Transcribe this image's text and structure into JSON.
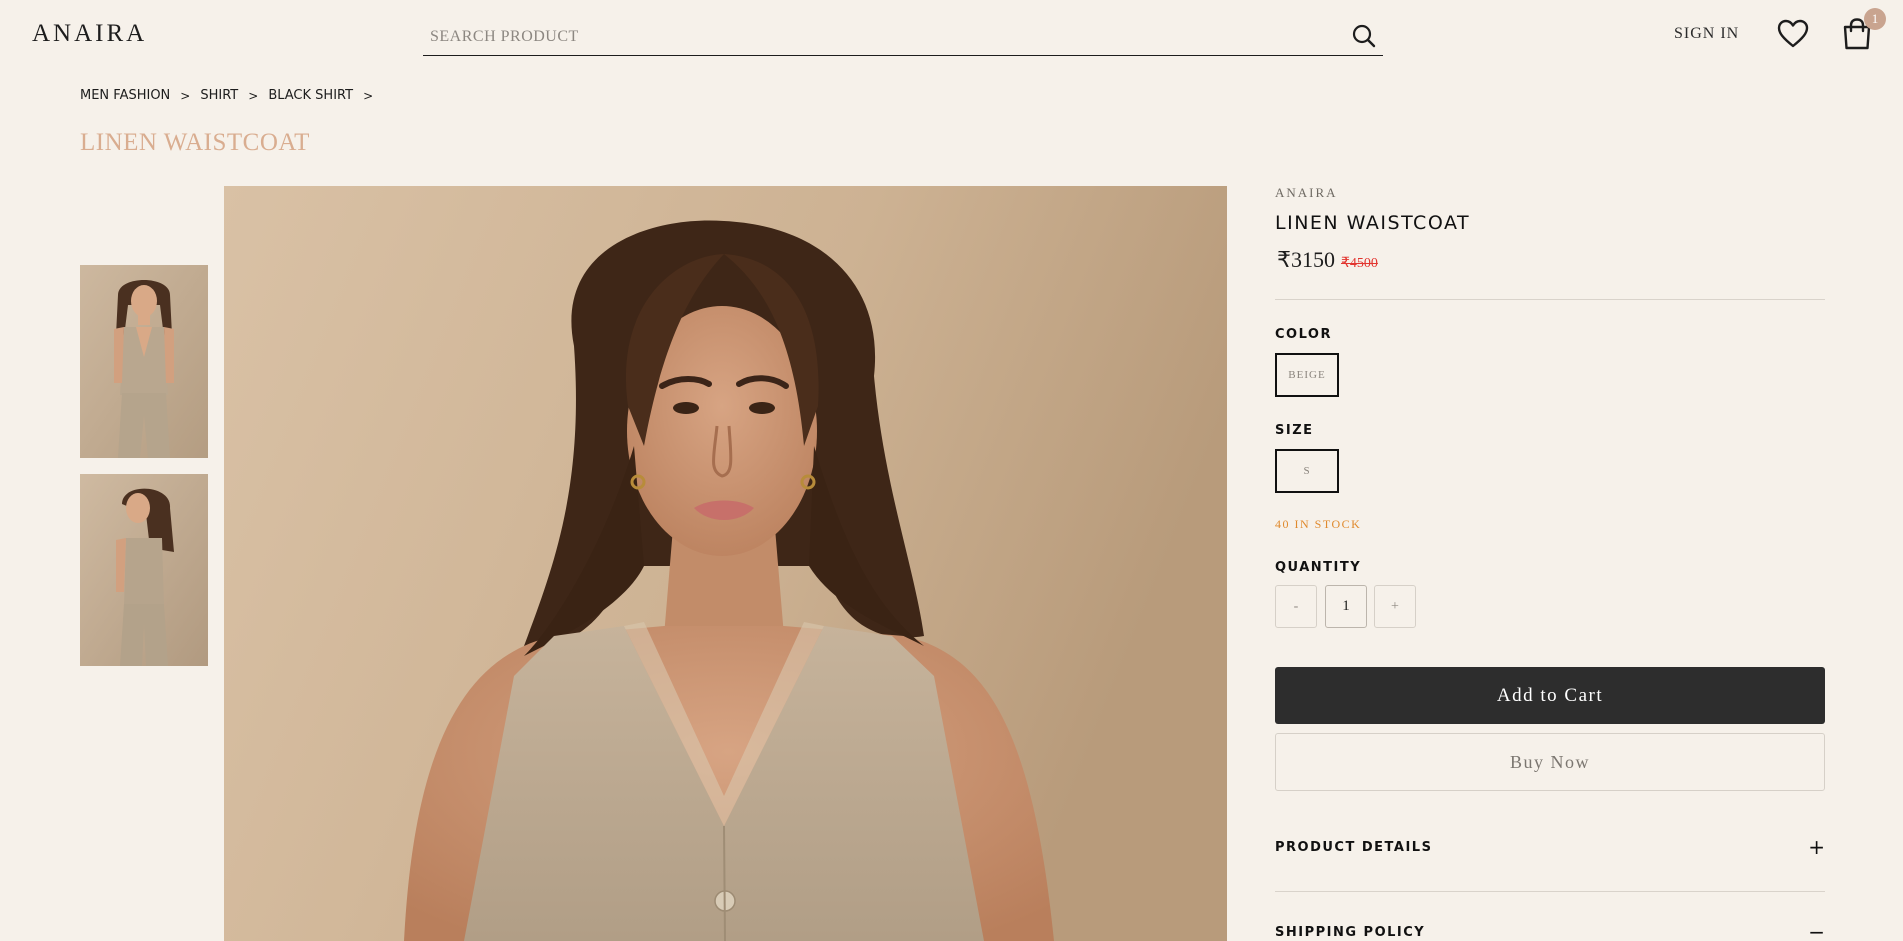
{
  "header": {
    "logo": "ANAIRA",
    "search_placeholder": "SEARCH PRODUCT",
    "sign_in": "SIGN IN",
    "cart_count": "1"
  },
  "breadcrumb": [
    "MEN FASHION",
    "SHIRT",
    "BLACK SHIRT"
  ],
  "page_title": "LINEN WAISTCOAT",
  "product": {
    "brand": "ANAIRA",
    "name": "LINEN WAISTCOAT",
    "price_current": "₹3150",
    "price_original": "₹4500",
    "color_label": "COLOR",
    "color_value": "BEIGE",
    "size_label": "SIZE",
    "size_value": "S",
    "stock_text": "40 IN STOCK",
    "quantity_label": "QUANTITY",
    "qty_minus": "-",
    "qty_value": "1",
    "qty_plus": "+",
    "add_to_cart": "Add to Cart",
    "buy_now": "Buy Now"
  },
  "accordions": [
    {
      "title": "PRODUCT DETAILS",
      "icon": "+"
    },
    {
      "title": "SHIPPING POLICY",
      "icon": "−"
    }
  ],
  "colors": {
    "background": "#f6f1ea",
    "accent_title": "#d9ad90",
    "price_strike": "#e2352f",
    "stock": "#e08a2d",
    "button_dark": "#2d2d2d",
    "badge": "#c9a48f"
  }
}
